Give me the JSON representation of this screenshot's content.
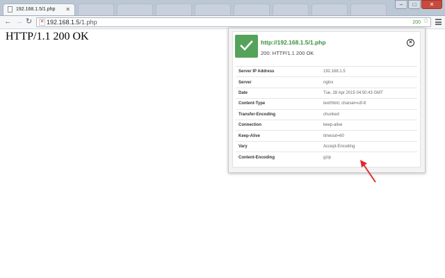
{
  "browser": {
    "active_tab_title": "192.168.1.5/1.php",
    "background_tabs": [
      "",
      "",
      "",
      "",
      "",
      "",
      "",
      ""
    ],
    "address": {
      "host": "192.168.1.5",
      "path": "/1.php"
    },
    "status_badge": "200",
    "window_controls": {
      "minimize": "–",
      "maximize": "□",
      "close": "✕"
    }
  },
  "page": {
    "response_text": "HTTP/1.1 200 OK"
  },
  "popup": {
    "url": "http://192.168.1.5/1.php",
    "status_line": "200: HTTP/1.1 200 OK",
    "close_glyph": "×",
    "headers": [
      {
        "name": "Server IP Address",
        "value": "192.168.1.5"
      },
      {
        "name": "Server",
        "value": "nginx"
      },
      {
        "name": "Date",
        "value": "Tue, 28 Apr 2015 04:50:43 GMT"
      },
      {
        "name": "Content-Type",
        "value": "text/html; charset=utf-8"
      },
      {
        "name": "Transfer-Encoding",
        "value": "chunked"
      },
      {
        "name": "Connection",
        "value": "keep-alive"
      },
      {
        "name": "Keep-Alive",
        "value": "timeout=60"
      },
      {
        "name": "Vary",
        "value": "Accept-Encoding"
      },
      {
        "name": "Content-Encoding",
        "value": "gzip"
      }
    ]
  },
  "icons": {
    "back": "back-arrow-icon",
    "forward": "forward-arrow-icon",
    "reload": "reload-icon",
    "star": "bookmark-star-icon",
    "menu": "menu-icon",
    "check": "check-icon",
    "close": "close-circle-icon",
    "annotation": "red-arrow-icon"
  },
  "colors": {
    "success_green": "#55a35a",
    "url_green": "#3a8f3c",
    "annotation_red": "#e02b2b"
  }
}
